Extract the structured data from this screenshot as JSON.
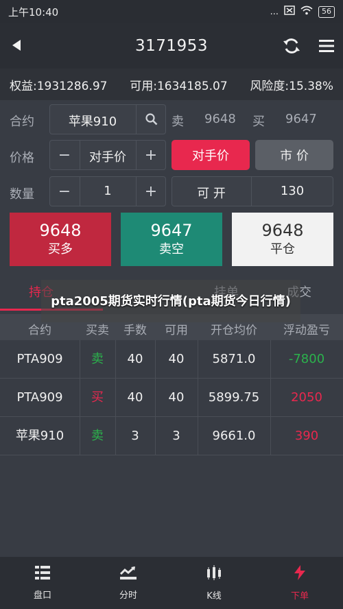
{
  "status_bar": {
    "time": "上午10:40",
    "dots": "...",
    "battery": "56"
  },
  "header": {
    "title": "3171953"
  },
  "account": {
    "equity": "权益:1931286.97",
    "available": "可用:1634185.07",
    "risk": "风险度:15.38%"
  },
  "contract": {
    "label": "合约",
    "value": "苹果910",
    "sell_label": "卖",
    "sell_price": "9648",
    "buy_label": "买",
    "buy_price": "9647"
  },
  "price": {
    "label": "价格",
    "minus": "−",
    "value": "对手价",
    "plus": "+",
    "counterparty_btn": "对手价",
    "market_btn": "市  价"
  },
  "quantity": {
    "label": "数量",
    "minus": "−",
    "value": "1",
    "plus": "+",
    "open_label": "可  开",
    "open_value": "130"
  },
  "orders": {
    "buy_long": {
      "price": "9648",
      "action": "买多"
    },
    "sell_short": {
      "price": "9647",
      "action": "卖空"
    },
    "close": {
      "price": "9648",
      "action": "平仓"
    }
  },
  "tabs": [
    {
      "label": "持仓"
    },
    {
      "label": "挂单"
    },
    {
      "label": "成交"
    }
  ],
  "overlay_text": "pta2005期货实时行情(pta期货今日行情)",
  "table": {
    "headers": [
      "合约",
      "买卖",
      "手数",
      "可用",
      "开仓均价",
      "浮动盈亏"
    ],
    "rows": [
      {
        "contract": "PTA909",
        "side": "卖",
        "qty": "40",
        "avail": "40",
        "avg": "5871.0",
        "pnl": "-7800"
      },
      {
        "contract": "PTA909",
        "side": "买",
        "qty": "40",
        "avail": "40",
        "avg": "5899.75",
        "pnl": "2050"
      },
      {
        "contract": "苹果910",
        "side": "卖",
        "qty": "3",
        "avail": "3",
        "avg": "9661.0",
        "pnl": "390"
      }
    ]
  },
  "bottom_nav": [
    {
      "label": "盘口",
      "icon": "orderbook-icon"
    },
    {
      "label": "分时",
      "icon": "timeshare-icon"
    },
    {
      "label": "K线",
      "icon": "candlestick-icon"
    },
    {
      "label": "下单",
      "icon": "lightning-icon"
    }
  ],
  "colors": {
    "red": "#e8284e",
    "green": "#2bb24c",
    "teal": "#1e8a75",
    "card_red": "#c0283f",
    "card_white": "#f2f2f2"
  }
}
